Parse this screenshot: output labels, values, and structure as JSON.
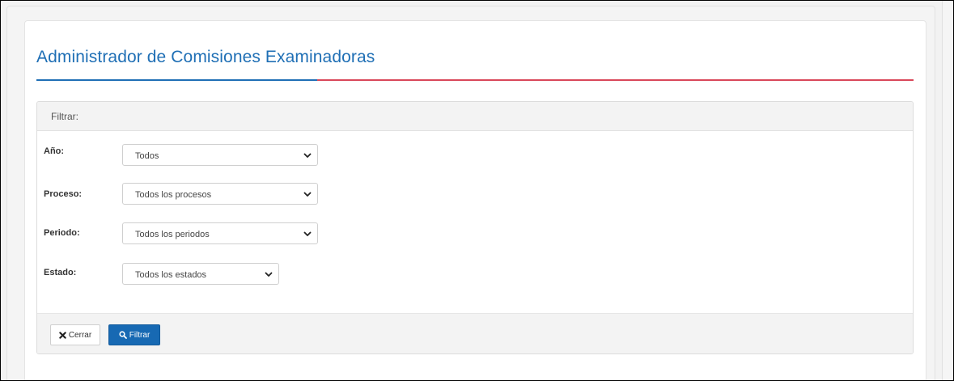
{
  "page": {
    "title": "Administrador de Comisiones Examinadoras"
  },
  "colors": {
    "accent_blue": "#1f6fb5",
    "accent_red": "#d9475a",
    "button_primary": "#1769b3"
  },
  "filter_panel": {
    "title": "Filtrar:",
    "fields": [
      {
        "label": "Año:",
        "value": "Todos"
      },
      {
        "label": "Proceso:",
        "value": "Todos los procesos"
      },
      {
        "label": "Periodo:",
        "value": "Todos los periodos"
      },
      {
        "label": "Estado:",
        "value": "Todos los estados"
      }
    ],
    "buttons": {
      "close": {
        "label": "Cerrar",
        "icon": "times-icon"
      },
      "filter": {
        "label": "Filtrar",
        "icon": "search-icon"
      }
    }
  }
}
